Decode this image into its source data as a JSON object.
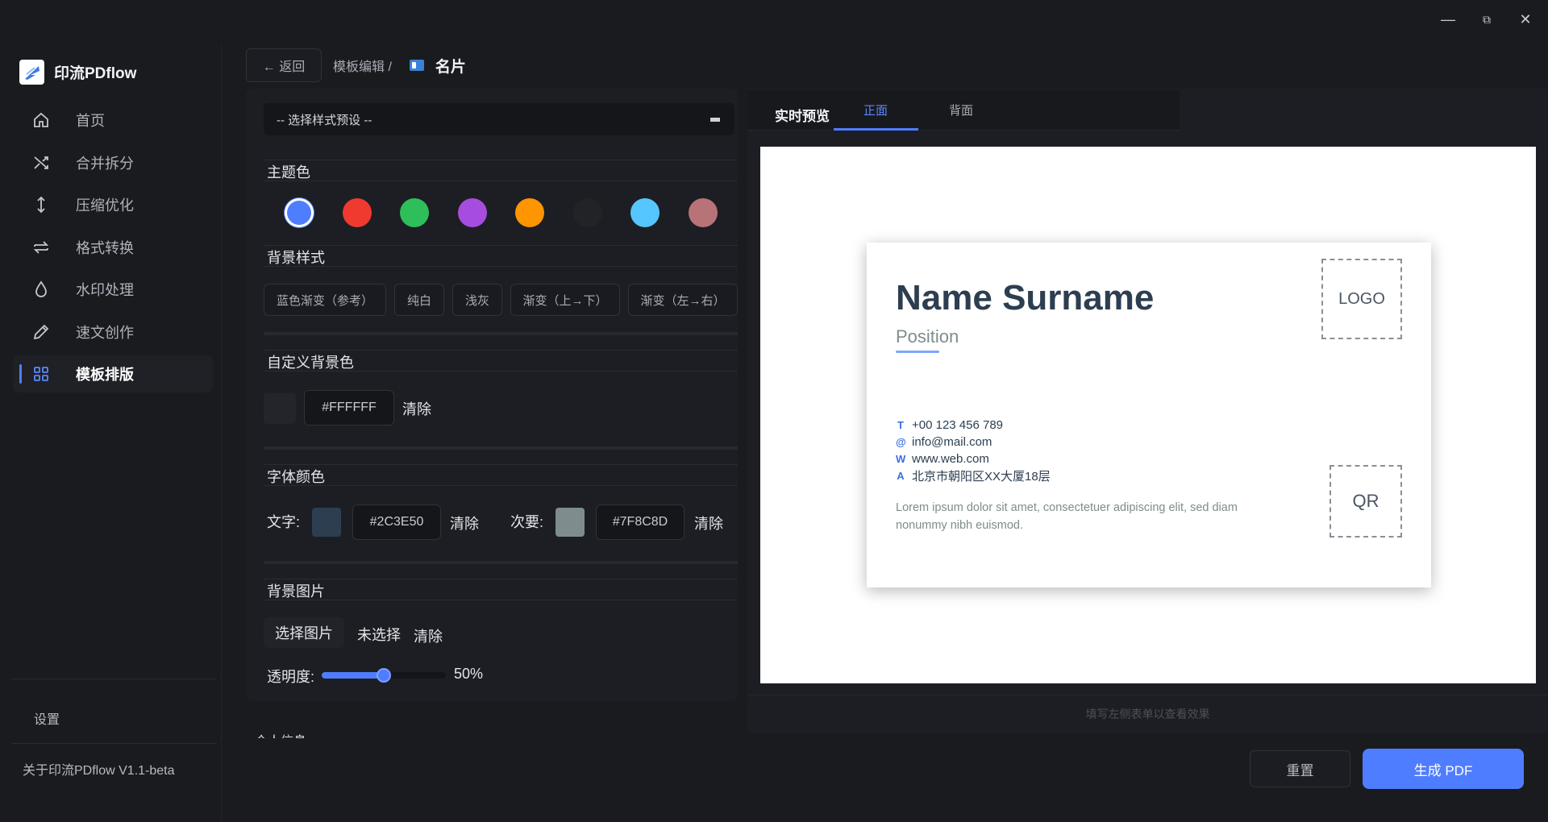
{
  "window": {
    "minimize": "—",
    "maximize": "⧉",
    "close": "✕"
  },
  "app": {
    "name": "印流PDflow"
  },
  "sidebar": {
    "items": [
      {
        "label": "首页",
        "icon": "home-icon",
        "active": false
      },
      {
        "label": "合并拆分",
        "icon": "shuffle-icon",
        "active": false
      },
      {
        "label": "压缩优化",
        "icon": "compress-arrows-icon",
        "active": false
      },
      {
        "label": "格式转换",
        "icon": "convert-arrows-icon",
        "active": false
      },
      {
        "label": "水印处理",
        "icon": "droplet-icon",
        "active": false
      },
      {
        "label": "速文创作",
        "icon": "pencil-icon",
        "active": false
      },
      {
        "label": "模板排版",
        "icon": "grid-icon",
        "active": true
      }
    ],
    "settings": "设置",
    "about": "关于印流PDflow  V1.1-beta"
  },
  "header": {
    "back": "← 返回",
    "breadcrumb": "模板编辑 /",
    "title": "名片"
  },
  "form": {
    "preset_placeholder": "-- 选择样式预设 --",
    "theme_color_label": "主题色",
    "theme_colors": [
      "#4f7dff",
      "#f03a30",
      "#2ebe5a",
      "#a64ddf",
      "#ff9500",
      "#222327",
      "#55c6ff",
      "#b87378"
    ],
    "bg_style_label": "背景样式",
    "bg_styles": [
      "蓝色渐变（参考）",
      "纯白",
      "浅灰",
      "渐变（上→下）",
      "渐变（左→右）"
    ],
    "custom_bg_label": "自定义背景色",
    "custom_bg_value": "#FFFFFF",
    "custom_bg_swatch": "#23252b",
    "clear": "清除",
    "font_color_label": "字体颜色",
    "text_color_label": "文字:",
    "text_color_value": "#2C3E50",
    "secondary_color_label": "次要:",
    "secondary_color_value": "#7F8C8D",
    "bg_image_label": "背景图片",
    "pick_image": "选择图片",
    "no_selection": "未选择",
    "opacity_label": "透明度:",
    "opacity_value": "50%",
    "opacity": 0.5,
    "next_section": "个人信息"
  },
  "preview": {
    "title": "实时预览",
    "tab_front": "正面",
    "tab_back": "背面",
    "hint": "填写左侧表单以查看效果",
    "card": {
      "name": "Name Surname",
      "position": "Position",
      "logo": "LOGO",
      "qr": "QR",
      "contacts": [
        {
          "key": "T",
          "value": "+00 123 456 789"
        },
        {
          "key": "@",
          "value": "info@mail.com"
        },
        {
          "key": "W",
          "value": "www.web.com"
        },
        {
          "key": "A",
          "value": "北京市朝阳区XX大厦18层"
        }
      ],
      "lorem": "Lorem ipsum dolor sit amet, consectetuer adipiscing elit, sed diam nonummy nibh euismod."
    }
  },
  "actions": {
    "reset": "重置",
    "generate": "生成 PDF"
  }
}
